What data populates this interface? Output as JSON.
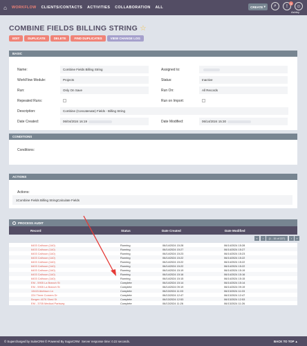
{
  "nav": {
    "items": [
      "WORKFLOW",
      "CLIENTS/CONTACTS",
      "ACTIVITIES",
      "COLLABORATION",
      "ALL"
    ],
    "create_label": "CREATE",
    "notifications": "9",
    "user": "Ashley"
  },
  "page": {
    "title": "COMBINE FIELDS BILLING STRING",
    "star": "☆"
  },
  "actions": [
    "EDIT",
    "DUPLICATE",
    "DELETE",
    "FIND DUPLICATES",
    "VIEW CHANGE LOG"
  ],
  "basic": {
    "header": "BASIC",
    "name_label": "Name:",
    "name_value": "Combine Fields Billing String",
    "assigned_label": "Assigned to:",
    "module_label": "WorkFlow Module:",
    "module_value": "Projects",
    "status_label": "Status:",
    "status_value": "Inactive",
    "run_label": "Run:",
    "run_value": "Only On Save",
    "runon_label": "Run On:",
    "runon_value": "All Records",
    "repeated_label": "Repeated Runs:",
    "import_label": "Run on Import:",
    "desc_label": "Description:",
    "desc_value": "Combine (Concatenate) Fields - Billing String",
    "created_label": "Date Created:",
    "created_value": "06/04/2024 16:19",
    "modified_label": "Date Modified:",
    "modified_value": "06/14/2024 15:30"
  },
  "conditions": {
    "header": "CONDITIONS",
    "label": "Conditions:"
  },
  "actions_panel": {
    "header": "ACTIONS",
    "label": "Actions:",
    "value": "1Combine Fields Billing StringCalculate Fields"
  },
  "process_audit": {
    "header": "PROCESS AUDIT",
    "columns": [
      "Record",
      "Status",
      "Date Created",
      "Date Modified"
    ],
    "pager": "(1 - 15 of 227)",
    "rows": [
      {
        "record": "6403 Calhoun (1A0)",
        "status": "Running",
        "created": "06/14/2024 15:28",
        "modified": "06/14/2024 15:28"
      },
      {
        "record": "6403 Calhoun (1A0)",
        "status": "Running",
        "created": "06/14/2024 15:27",
        "modified": "06/14/2024 15:27"
      },
      {
        "record": "6403 Calhoun (1A0)",
        "status": "Running",
        "created": "06/14/2024 15:23",
        "modified": "06/14/2024 15:23"
      },
      {
        "record": "6403 Calhoun (1A0)",
        "status": "Running",
        "created": "06/14/2024 15:22",
        "modified": "06/14/2024 15:22"
      },
      {
        "record": "6403 Calhoun (1A0)",
        "status": "Running",
        "created": "06/14/2024 15:22",
        "modified": "06/14/2024 15:22"
      },
      {
        "record": "6403 Calhoun (1A0)",
        "status": "Running",
        "created": "06/14/2024 15:22",
        "modified": "06/14/2024 15:22"
      },
      {
        "record": "6403 Calhoun (1A0)",
        "status": "Running",
        "created": "06/14/2024 15:19",
        "modified": "06/14/2024 15:19"
      },
      {
        "record": "6403 Calhoun (1A0)",
        "status": "Running",
        "created": "06/14/2024 15:16",
        "modified": "06/14/2024 15:16"
      },
      {
        "record": "6403 Calhoun (1A0)",
        "status": "Running",
        "created": "06/14/2024 15:15",
        "modified": "06/14/2024 15:15"
      },
      {
        "record": "EM - 5905 La Branch St",
        "status": "Complete",
        "created": "06/14/2024 15:14",
        "modified": "06/14/2024 15:14"
      },
      {
        "record": "EM - 5905 La Branch St",
        "status": "Complete",
        "created": "06/14/2024 09:19",
        "modified": "06/14/2024 09:19"
      },
      {
        "record": "13415 Atchison Ln",
        "status": "Complete",
        "created": "06/13/2024 11:03",
        "modified": "06/13/2024 11:03"
      },
      {
        "record": "224 Three Corners Dr",
        "status": "Complete",
        "created": "06/13/2024 12:47",
        "modified": "06/13/2024 12:47"
      },
      {
        "record": "Bergen 4076 Shed St",
        "status": "Complete",
        "created": "06/13/2024 12:53",
        "modified": "06/13/2024 12:53"
      },
      {
        "record": "EM - 3705 Medical Parkway",
        "status": "Complete",
        "created": "06/13/2024 11:26",
        "modified": "06/13/2024 11:26"
      }
    ]
  },
  "footer": {
    "left": "© Supercharged by SuiteCRM   © Powered By SugarCRM",
    "server": "Server response time: 0.22 seconds.",
    "top": "BACK TO TOP ▲"
  },
  "colors": {
    "nav_bg": "#534d64",
    "accent": "#f08377",
    "panel_header": "#778591",
    "link": "#e05b4f",
    "arrow": "#e53935"
  }
}
